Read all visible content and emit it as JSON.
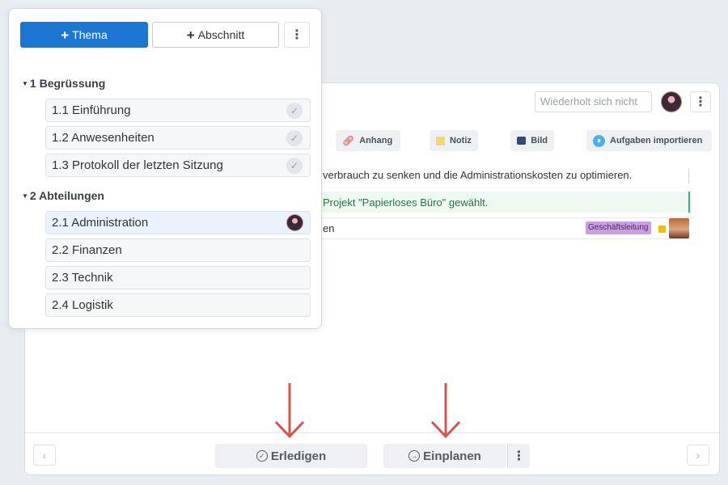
{
  "main": {
    "repeat_field": "Wiederholt sich nicht",
    "toolbar": {
      "attachment": "Anhang",
      "note": "Notiz",
      "image": "Bild",
      "import_tasks": "Aufgaben importieren"
    },
    "lines": [
      "verbrauch zu senken und die Administrationskosten zu optimieren.",
      "Projekt \"Papierloses Büro\" gewählt.",
      "en"
    ],
    "tag": "Geschäftsleitung",
    "footer": {
      "complete": "Erledigen",
      "schedule": "Einplanen"
    }
  },
  "popup": {
    "add_topic": "Thema",
    "add_section": "Abschnitt",
    "sections": [
      {
        "title": "1 Begrüssung",
        "items": [
          "1.1 Einführung",
          "1.2 Anwesenheiten",
          "1.3 Protokoll der letzten Sitzung"
        ]
      },
      {
        "title": "2 Abteilungen",
        "items": [
          "2.1 Administration",
          "2.2 Finanzen",
          "2.3 Technik",
          "2.4 Logistik"
        ]
      }
    ]
  },
  "icons": {
    "add": "plus-icon",
    "more": "kebab-icon",
    "attachment": "paperclip-icon",
    "note": "note-icon",
    "image": "image-icon",
    "import": "import-icon",
    "done": "check-circle-icon",
    "schedule": "arrow-circle-icon"
  },
  "colors": {
    "primary": "#1d76d2",
    "tag": "#c9a0e2",
    "success": "#3fb36e",
    "arrow": "#d9534f"
  }
}
